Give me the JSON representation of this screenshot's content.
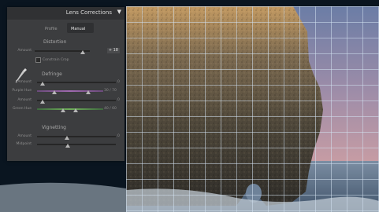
{
  "panel": {
    "title": "Lens Corrections",
    "collapse_icon": "triangle-down-icon",
    "tabs": [
      {
        "label": "Profile",
        "active": false
      },
      {
        "label": "Manual",
        "active": true
      }
    ],
    "distortion": {
      "heading": "Distortion",
      "amount_label": "Amount",
      "amount_value": "+ 18",
      "constrain_crop_label": "Constrain Crop"
    },
    "tool_icon": "eyedropper-icon",
    "defringe": {
      "heading": "Defringe",
      "rows": [
        {
          "label": "Amount",
          "value": "0"
        },
        {
          "label": "Purple Hue",
          "value": "30 / 70"
        },
        {
          "label": "Amount",
          "value": "0"
        },
        {
          "label": "Green Hue",
          "value": "40 / 60"
        }
      ]
    },
    "vignetting": {
      "heading": "Vignetting",
      "rows": [
        {
          "label": "Amount",
          "value": "0"
        },
        {
          "label": "Midpoint",
          "value": ""
        }
      ]
    }
  },
  "colors": {
    "panel_bg": "#3c3d3f",
    "sky_top": "#6c7fa8",
    "sky_bottom": "#e0a4a0",
    "sea": "#5a6f86",
    "rock": "#5e5546",
    "grid": "#d2e1f0"
  }
}
